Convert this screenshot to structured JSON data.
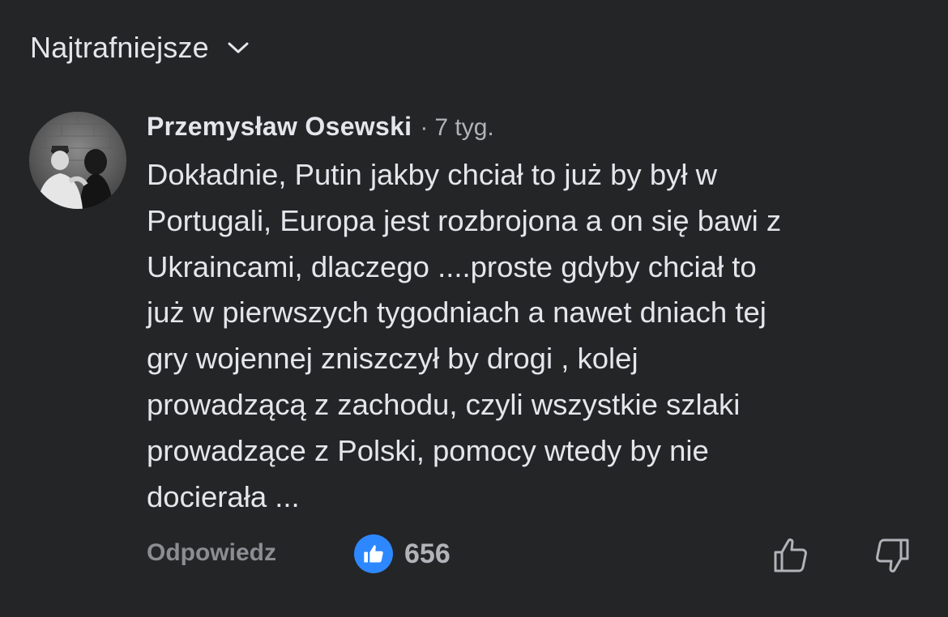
{
  "sort": {
    "label": "Najtrafniejsze",
    "chevron_icon": "chevron-down-icon"
  },
  "comment": {
    "author": "Przemysław Osewski",
    "separator": "·",
    "timestamp": "7 tyg.",
    "text": "Dokładnie, Putin jakby chciał to już by był w\nPortugali, Europa jest rozbrojona a on się bawi z\nUkraincami, dlaczego ....proste gdyby chciał to\njuż w pierwszych tygodniach a nawet dniach tej\ngry wojennej zniszczył by drogi , kolej\nprowadzącą z zachodu, czyli wszystkie szlaki\nprowadzące z Polski, pomocy wtedy by nie\ndocierała ...",
    "avatar_icon": "user-avatar"
  },
  "actions": {
    "reply_label": "Odpowiedz",
    "reaction_icon": "thumbs-up-icon",
    "reaction_count": "656",
    "like_icon": "thumbs-up-outline-icon",
    "dislike_icon": "thumbs-down-outline-icon"
  },
  "colors": {
    "background": "#242526",
    "text_primary": "#e4e6eb",
    "text_secondary": "#b0b3b8",
    "accent_blue": "#2d88ff"
  }
}
